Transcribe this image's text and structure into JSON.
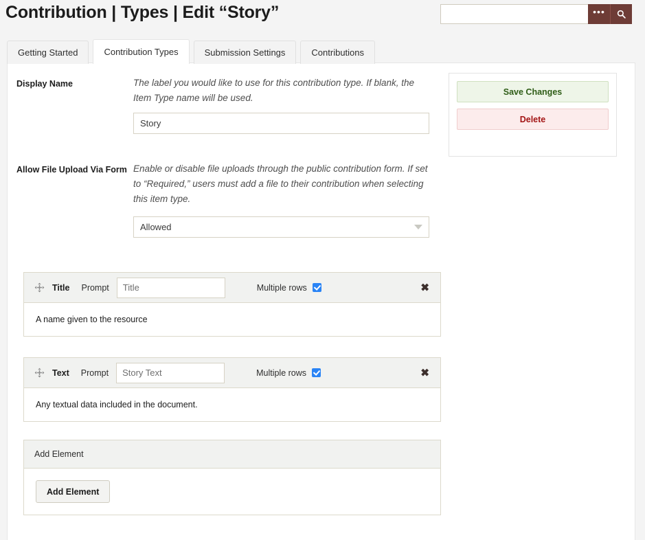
{
  "header": {
    "title": "Contribution | Types | Edit “Story”",
    "search": {
      "value": "",
      "placeholder": "",
      "advanced_label": "•••",
      "submit_icon": "search-icon"
    }
  },
  "tabs": [
    {
      "label": "Getting Started",
      "active": false
    },
    {
      "label": "Contribution Types",
      "active": true
    },
    {
      "label": "Submission Settings",
      "active": false
    },
    {
      "label": "Contributions",
      "active": false
    }
  ],
  "fields": [
    {
      "label": "Display Name",
      "description": "The label you would like to use for this contribution type. If blank, the Item Type name will be used.",
      "input_value": "Story",
      "input_placeholder": ""
    },
    {
      "label": "Allow File Upload Via Form",
      "description": "Enable or disable file uploads through the public contribution form. If set to “Required,” users must add a file to their contribution when selecting this item type.",
      "select_value": "Allowed"
    }
  ],
  "actions": {
    "save_label": "Save Changes",
    "delete_label": "Delete",
    "save_color": "#2f5d17",
    "delete_color": "#a31515"
  },
  "elements": [
    {
      "name": "Title",
      "prompt_label": "Prompt",
      "prompt_value": "Title",
      "multiple_rows_label": "Multiple rows",
      "multiple_rows_checked": true,
      "close_label": "✖",
      "description": "A name given to the resource"
    },
    {
      "name": "Text",
      "prompt_label": "Prompt",
      "prompt_value": "Story Text",
      "multiple_rows_label": "Multiple rows",
      "multiple_rows_checked": true,
      "close_label": "✖",
      "description": "Any textual data included in the document."
    }
  ],
  "add_element": {
    "section_label": "Add Element",
    "button_label": "Add Element"
  },
  "colors": {
    "brand": "#6e3c36",
    "checkbox": "#2a84f5",
    "panel_bg": "#ffffff",
    "page_bg": "#f4f4f4"
  }
}
